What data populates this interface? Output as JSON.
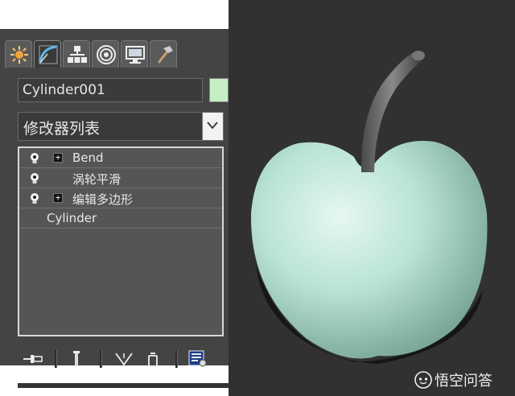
{
  "object_name": "Cylinder001",
  "modifier_list": {
    "label": "修改器列表"
  },
  "stack": [
    {
      "label": "Bend",
      "has_expand": true,
      "expand_symbol": "+"
    },
    {
      "label": "涡轮平滑",
      "has_expand": false
    },
    {
      "label": "编辑多边形",
      "has_expand": true,
      "expand_symbol": "+"
    },
    {
      "label": "Cylinder",
      "has_expand": false
    }
  ],
  "watermark": {
    "text": "悟空问答",
    "icon": "wukong-icon"
  },
  "tabs": [
    {
      "icon": "create-sun-icon"
    },
    {
      "icon": "modify-arc-icon",
      "active": true
    },
    {
      "icon": "hierarchy-icon"
    },
    {
      "icon": "motion-target-icon"
    },
    {
      "icon": "display-monitor-icon"
    },
    {
      "icon": "utilities-hammer-icon"
    }
  ],
  "colors": {
    "panel_bg": "#444444",
    "viewport_bg": "#313131",
    "object_color_swatch": "#c4efc4",
    "apple_color": "#b9e3d6"
  }
}
